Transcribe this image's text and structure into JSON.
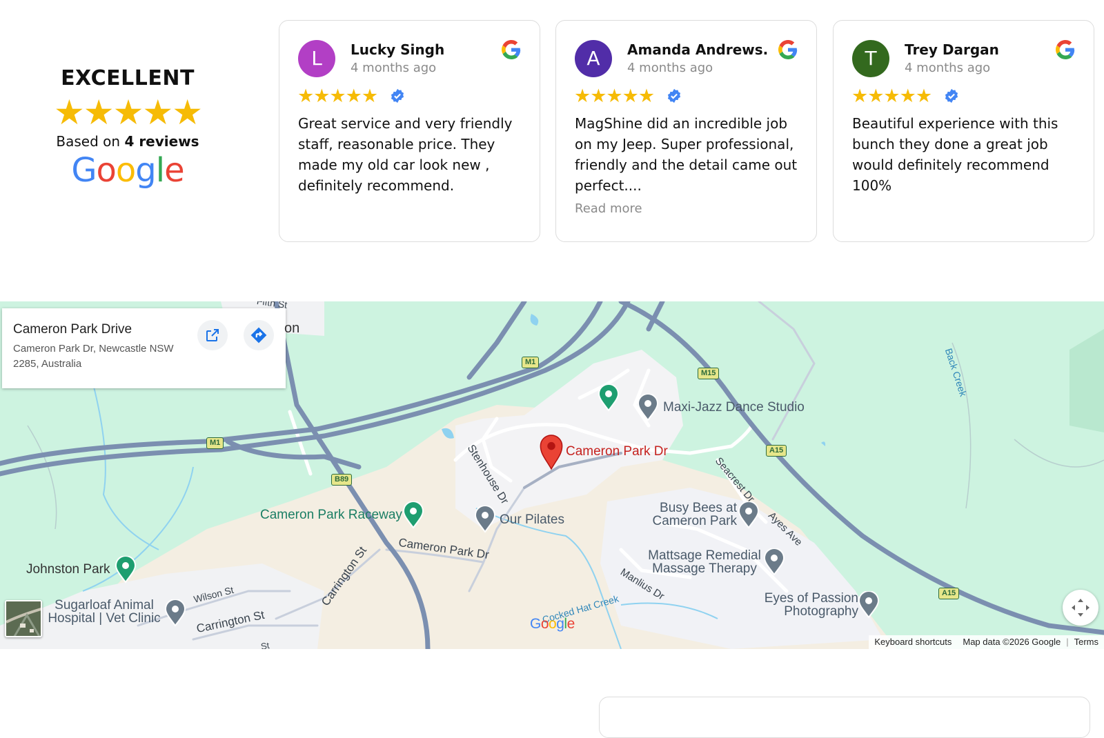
{
  "summary": {
    "rating_label": "EXCELLENT",
    "stars": "★★★★★",
    "based_prefix": "Based on",
    "based_count": "4 reviews",
    "brand": "Google"
  },
  "reviews": [
    {
      "initial": "L",
      "avatar_color": "#b23fc5",
      "name": "Lucky Singh",
      "time": "4 months ago",
      "stars": "★★★★★",
      "text": "Great service and very friendly staff, reasonable price. They made my old car look new , definitely recommend.",
      "read_more": ""
    },
    {
      "initial": "A",
      "avatar_color": "#512da8",
      "name": "Amanda Andrews...",
      "time": "4 months ago",
      "stars": "★★★★★",
      "text": "MagShine did an incredible job on my Jeep. Super professional, friendly and the detail came out perfect....",
      "read_more": "Read more"
    },
    {
      "initial": "T",
      "avatar_color": "#33691e",
      "name": "Trey Dargan",
      "time": "4 months ago",
      "stars": "★★★★★",
      "text": "Beautiful experience with this bunch they done a great job would definitely recommend 100%",
      "read_more": ""
    }
  ],
  "map": {
    "place_title": "Cameron Park Drive",
    "place_address": "Cameron Park Dr, Newcastle NSW 2285, Australia",
    "marker_label": "Cameron Park Dr",
    "labels": {
      "fifth_st": "Fifth St",
      "on_fragment": "on",
      "maxi_jazz": "Maxi-Jazz Dance Studio",
      "stenhouse": "Stenhouse Dr",
      "seacrest": "Seacrest Dr",
      "ayes": "Ayes Ave",
      "back_creek": "Back Creek",
      "raceway": "Cameron Park Raceway",
      "pilates": "Our Pilates",
      "busy_bees": "Busy Bees at Cameron Park",
      "mattsage": "Mattsage Remedial Massage Therapy",
      "manlius": "Manlius Dr",
      "eyes_passion": "Eyes of Passion Photography",
      "cameron_park_dr_road": "Cameron Park Dr",
      "carrington_st_diag": "Carrington St",
      "carrington_st": "Carrington St",
      "wilson_st": "Wilson St",
      "johnston": "Johnston Park",
      "sugarloaf": "Sugarloaf Animal Hospital | Vet Clinic",
      "cockedhat": "Cocked Hat Creek",
      "st_fragment": "St"
    },
    "shields": {
      "m1_top": "M1",
      "m1_left": "M1",
      "m15": "M15",
      "a15_mid": "A15",
      "a15_low": "A15",
      "b89": "B89"
    },
    "brand": "Google",
    "attribution": {
      "shortcuts": "Keyboard shortcuts",
      "mapdata": "Map data ©2026 Google",
      "terms": "Terms"
    }
  },
  "colors": {
    "star": "#f6bb06",
    "verified": "#4285f4",
    "map_green": "#cdf3e0",
    "highway": "#7b8fb0",
    "marker": "#ea4335"
  }
}
